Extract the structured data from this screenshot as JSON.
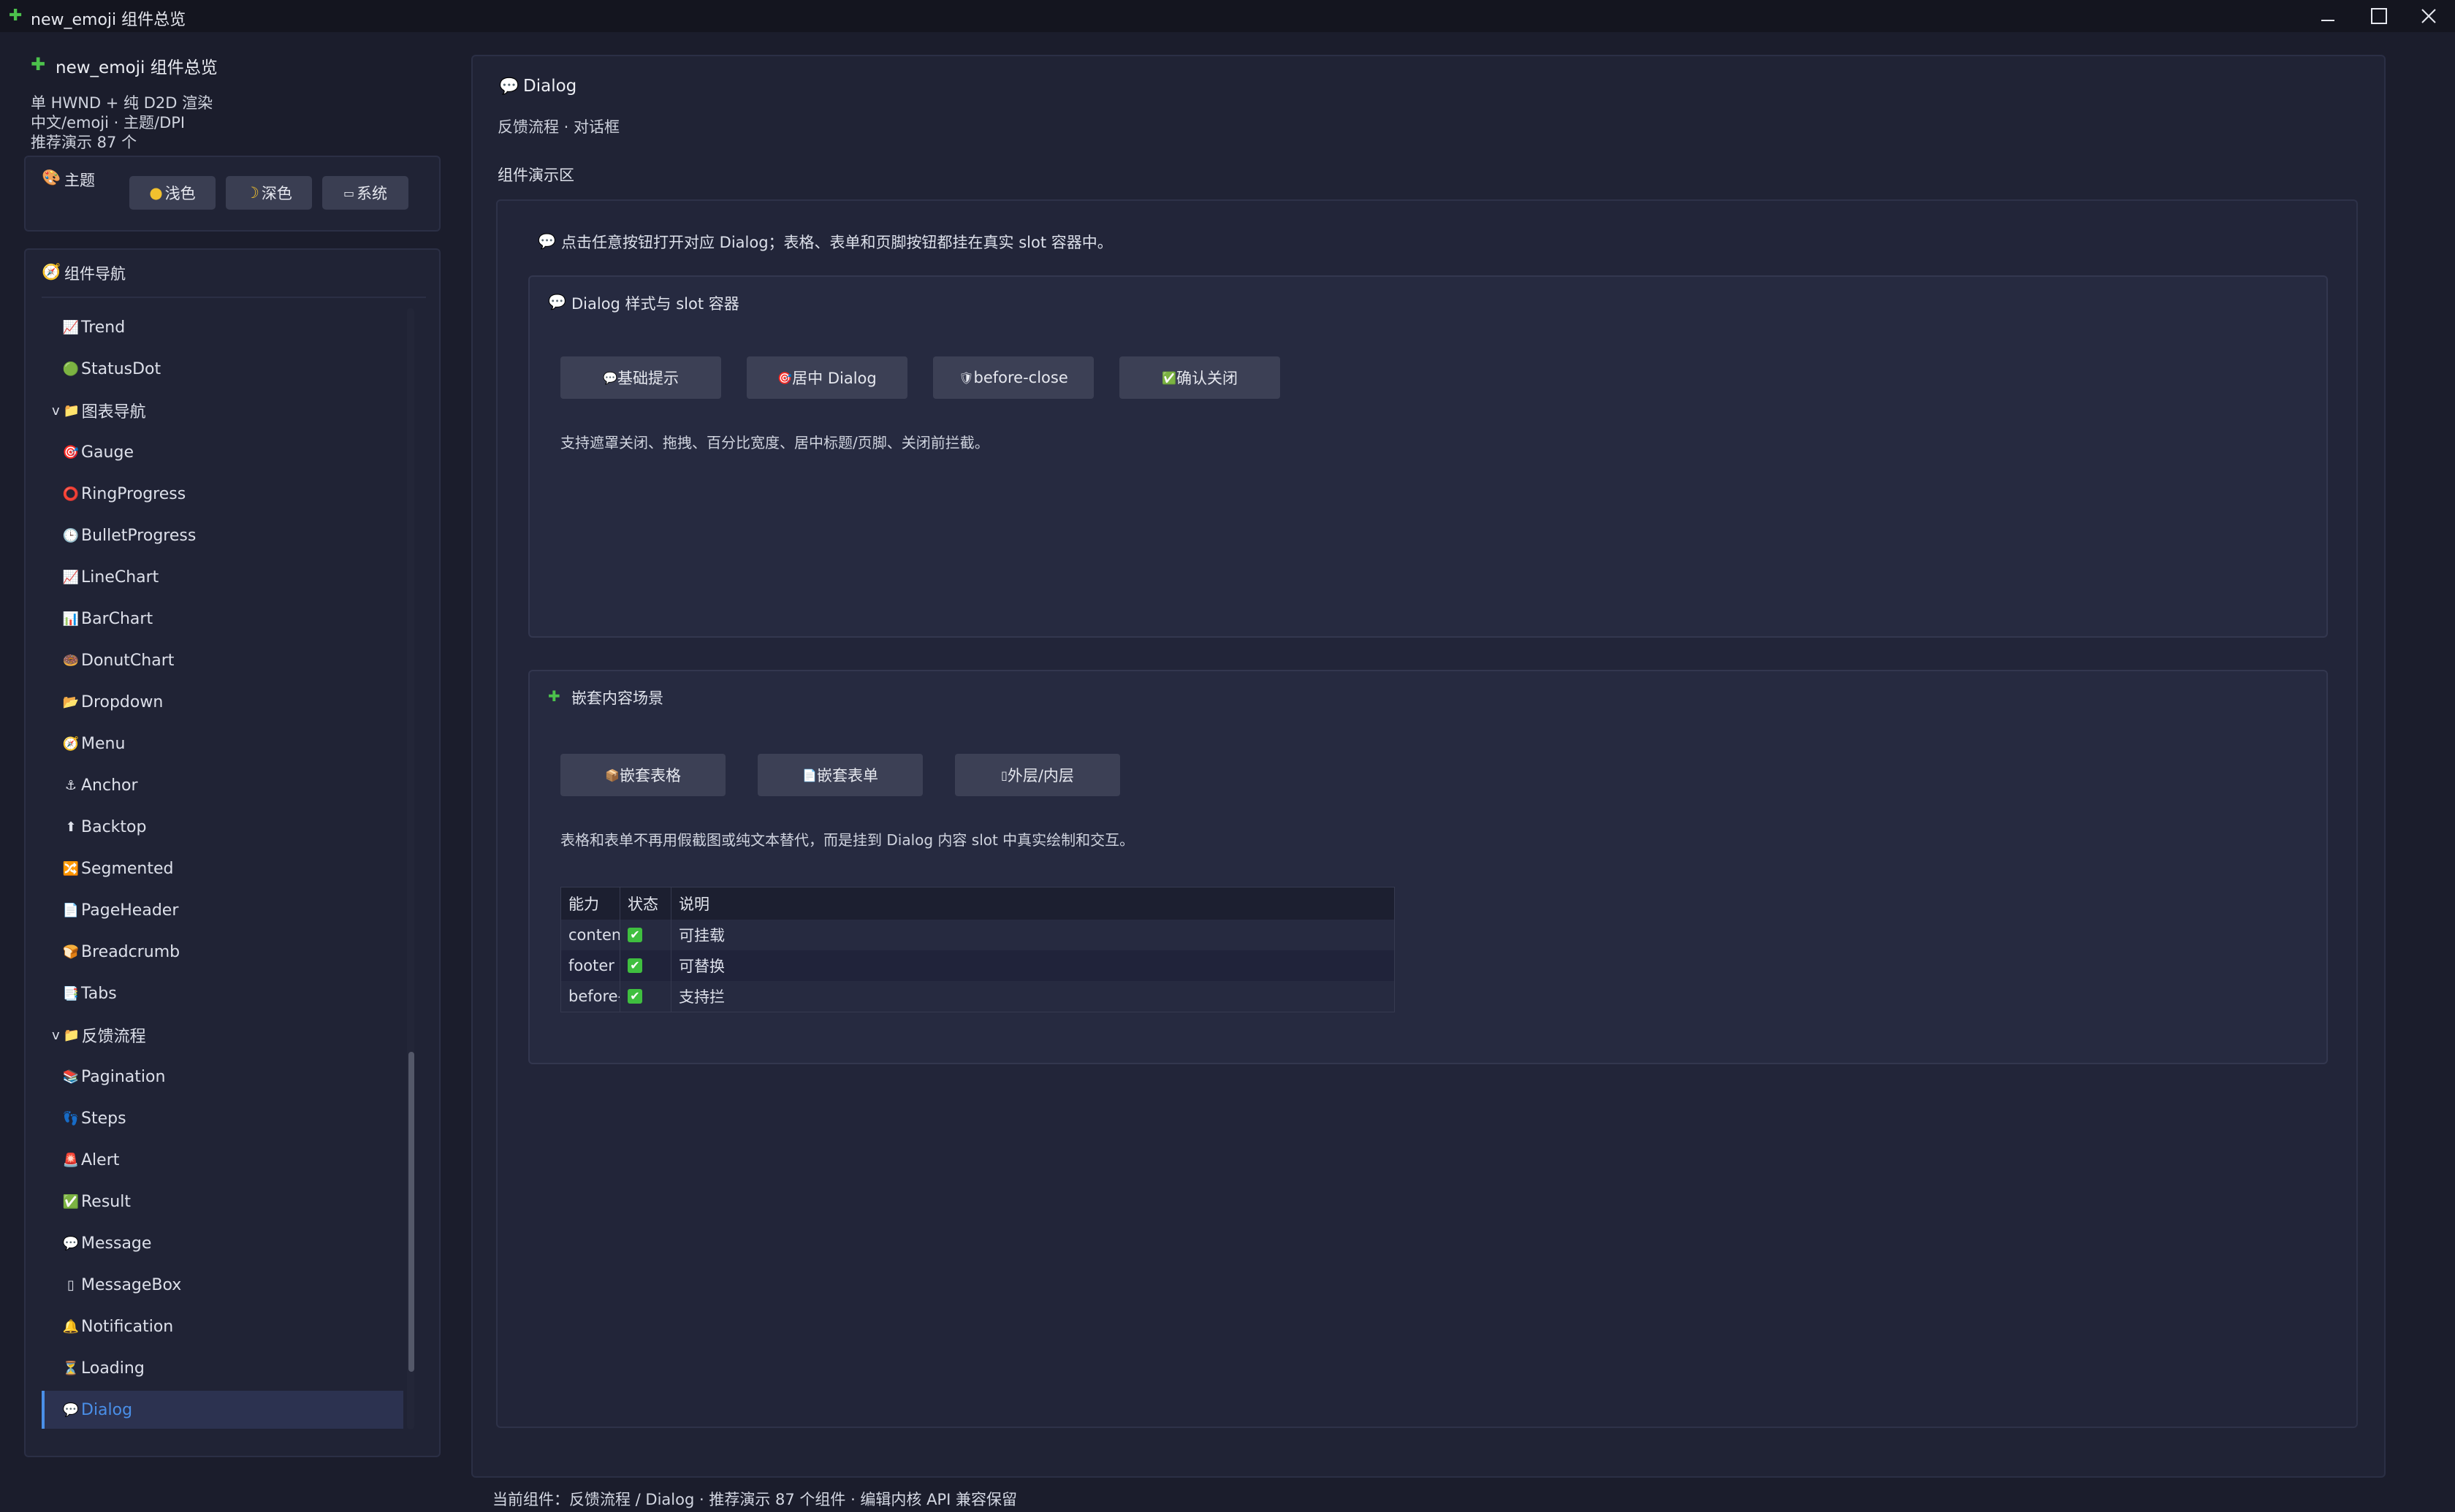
{
  "window": {
    "title_icon": "puzzle-icon",
    "title": "new_emoji 组件总览",
    "controls": [
      "minimize",
      "maximize",
      "close"
    ]
  },
  "sidebar": {
    "app_title": "new_emoji 组件总览",
    "info_lines": [
      "单 HWND + 纯 D2D 渲染",
      "中文/emoji · 主题/DPI",
      "推荐演示 87 个"
    ],
    "theme": {
      "label": "主题",
      "buttons": [
        {
          "label": "浅色",
          "icon": "sun-icon"
        },
        {
          "label": "深色",
          "icon": "moon-icon"
        },
        {
          "label": "系统",
          "icon": "laptop-icon"
        }
      ]
    },
    "nav": {
      "title": "组件导航",
      "items": [
        {
          "label": "Trend",
          "icon": "📈",
          "type": "leaf"
        },
        {
          "label": "StatusDot",
          "icon": "🟢",
          "type": "leaf"
        },
        {
          "label": "图表导航",
          "icon": "📁",
          "type": "group",
          "prefix": "v"
        },
        {
          "label": "Gauge",
          "icon": "🎯",
          "type": "leaf"
        },
        {
          "label": "RingProgress",
          "icon": "⭕",
          "type": "leaf"
        },
        {
          "label": "BulletProgress",
          "icon": "🕒",
          "type": "leaf"
        },
        {
          "label": "LineChart",
          "icon": "📈",
          "type": "leaf"
        },
        {
          "label": "BarChart",
          "icon": "📊",
          "type": "leaf"
        },
        {
          "label": "DonutChart",
          "icon": "🍩",
          "type": "leaf"
        },
        {
          "label": "Dropdown",
          "icon": "📂",
          "type": "leaf"
        },
        {
          "label": "Menu",
          "icon": "🧭",
          "type": "leaf"
        },
        {
          "label": "Anchor",
          "icon": "⚓",
          "type": "leaf"
        },
        {
          "label": "Backtop",
          "icon": "⬆",
          "type": "leaf"
        },
        {
          "label": "Segmented",
          "icon": "🔀",
          "type": "leaf"
        },
        {
          "label": "PageHeader",
          "icon": "📄",
          "type": "leaf"
        },
        {
          "label": "Breadcrumb",
          "icon": "🍞",
          "type": "leaf"
        },
        {
          "label": "Tabs",
          "icon": "📑",
          "type": "leaf"
        },
        {
          "label": "反馈流程",
          "icon": "📁",
          "type": "group",
          "prefix": "v"
        },
        {
          "label": "Pagination",
          "icon": "📚",
          "type": "leaf"
        },
        {
          "label": "Steps",
          "icon": "👣",
          "type": "leaf"
        },
        {
          "label": "Alert",
          "icon": "🚨",
          "type": "leaf"
        },
        {
          "label": "Result",
          "icon": "✅",
          "type": "leaf"
        },
        {
          "label": "Message",
          "icon": "💬",
          "type": "leaf"
        },
        {
          "label": "MessageBox",
          "icon": "▯",
          "type": "leaf"
        },
        {
          "label": "Notification",
          "icon": "🔔",
          "type": "leaf"
        },
        {
          "label": "Loading",
          "icon": "⏳",
          "type": "leaf"
        },
        {
          "label": "Dialog",
          "icon": "💬",
          "type": "leaf",
          "selected": true
        }
      ]
    }
  },
  "main": {
    "title": "Dialog",
    "breadcrumb": "反馈流程 · 对话框",
    "demo_label": "组件演示区",
    "hint": "点击任意按钮打开对应 Dialog；表格、表单和页脚按钮都挂在真实 slot 容器中。",
    "card1": {
      "title": "Dialog 样式与 slot 容器",
      "buttons": [
        {
          "label": "基础提示",
          "icon": "💬"
        },
        {
          "label": "居中 Dialog",
          "icon": "🎯"
        },
        {
          "label": "before-close",
          "icon": "🛡"
        },
        {
          "label": "确认关闭",
          "icon": "✅"
        }
      ],
      "description": "支持遮罩关闭、拖拽、百分比宽度、居中标题/页脚、关闭前拦截。"
    },
    "card2": {
      "title": "嵌套内容场景",
      "buttons": [
        {
          "label": "嵌套表格",
          "icon": "📦"
        },
        {
          "label": "嵌套表单",
          "icon": "📄"
        },
        {
          "label": "外层/内层",
          "icon": "▯"
        }
      ],
      "description": "表格和表单不再用假截图或纯文本替代，而是挂到 Dialog 内容 slot 中真实绘制和交互。",
      "table": {
        "headers": [
          "能力",
          "状态",
          "说明"
        ],
        "rows": [
          [
            "conten",
            "✔",
            "可挂载"
          ],
          [
            "footer",
            "✔",
            "可替换"
          ],
          [
            "before-",
            "✔",
            "支持拦"
          ]
        ]
      }
    }
  },
  "status_bar": "当前组件：反馈流程 / Dialog · 推荐演示 87 个组件 · 编辑内核 API 兼容保留",
  "colors": {
    "background": "#1b1d2c",
    "panel": "#202335",
    "accent": "#4a8fe8",
    "check": "#3fbf3f"
  }
}
